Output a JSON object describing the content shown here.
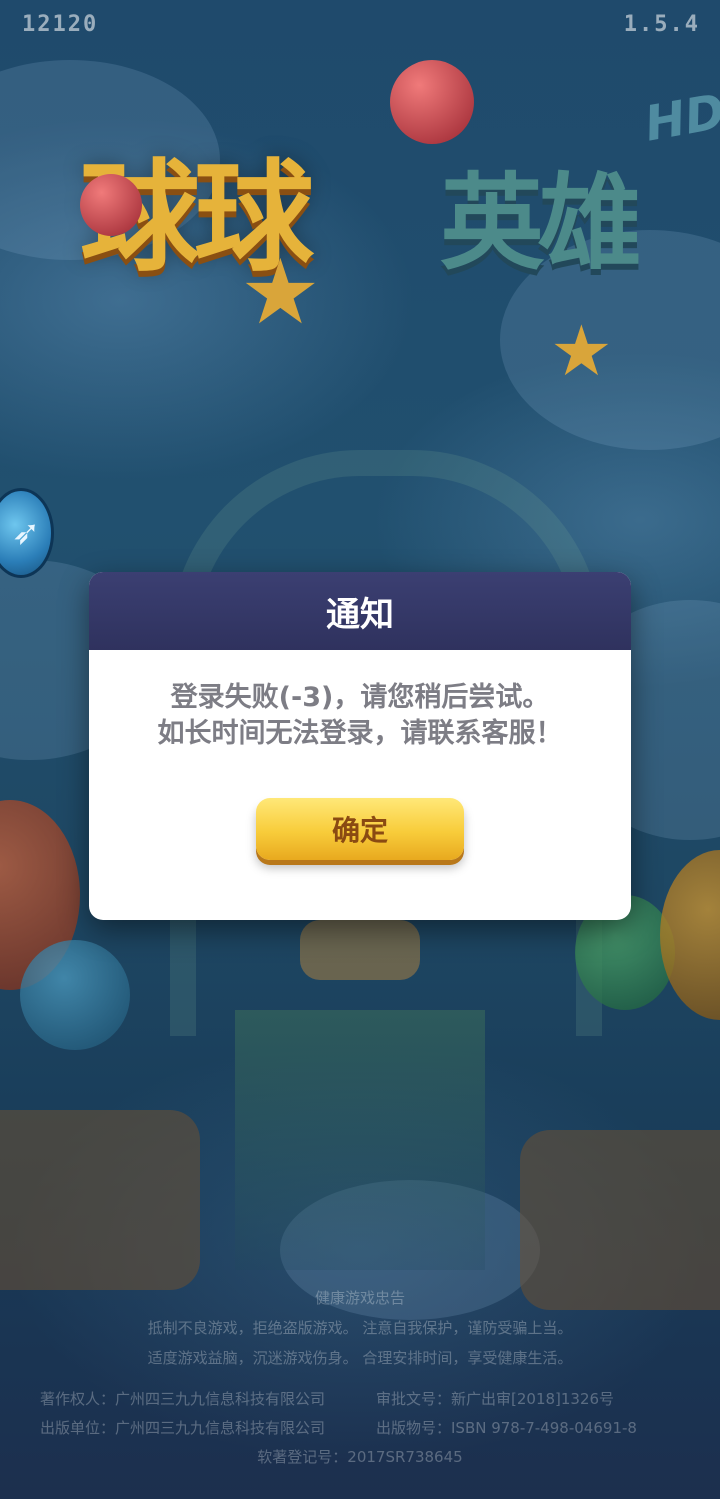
{
  "header": {
    "score": "12120",
    "version": "1.5.4"
  },
  "logo": {
    "main": "球球",
    "sub": "英雄",
    "badge": "HD"
  },
  "dialog": {
    "title": "通知",
    "message_line1": "登录失败(-3)，请您稍后尝试。",
    "message_line2": "如长时间无法登录，请联系客服！",
    "confirm_label": "确定"
  },
  "footer": {
    "health_title": "健康游戏忠告",
    "health_line1": "抵制不良游戏，拒绝盗版游戏。 注意自我保护，谨防受骗上当。",
    "health_line2": "适度游戏益脑，沉迷游戏伤身。 合理安排时间，享受健康生活。",
    "copyright_owner": "著作权人：广州四三九九信息科技有限公司",
    "approval_no": "审批文号：新广出审[2018]1326号",
    "publisher": "出版单位：广州四三九九信息科技有限公司",
    "isbn": "出版物号：ISBN 978-7-498-04691-8",
    "software_reg": "软著登记号：2017SR738645"
  },
  "icons": {
    "side": "shark-icon"
  }
}
